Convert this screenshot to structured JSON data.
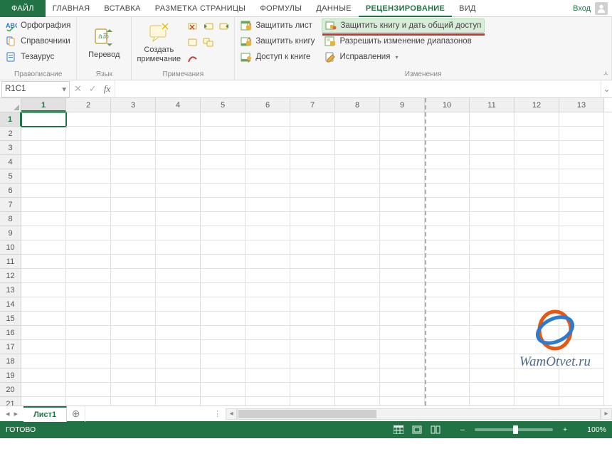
{
  "tabs": {
    "file": "ФАЙЛ",
    "home": "ГЛАВНАЯ",
    "insert": "ВСТАВКА",
    "page_layout": "РАЗМЕТКА СТРАНИЦЫ",
    "formulas": "ФОРМУЛЫ",
    "data": "ДАННЫЕ",
    "review": "РЕЦЕНЗИРОВАНИЕ",
    "view": "ВИД",
    "sign_in": "Вход"
  },
  "ribbon": {
    "proofing_group": "Правописание",
    "spelling": "Орфография",
    "research": "Справочники",
    "thesaurus": "Тезаурус",
    "language_group": "Язык",
    "translate": "Перевод",
    "comments_group": "Примечания",
    "new_comment": "Создать примечание",
    "changes_group": "Изменения",
    "protect_sheet": "Защитить лист",
    "protect_book": "Защитить книгу",
    "share_book": "Доступ к книге",
    "protect_share": "Защитить книгу и дать общий доступ",
    "allow_ranges": "Разрешить изменение диапазонов",
    "track_changes": "Исправления"
  },
  "formula_bar": {
    "name_box": "R1C1"
  },
  "grid": {
    "columns": [
      "1",
      "2",
      "3",
      "4",
      "5",
      "6",
      "7",
      "8",
      "9",
      "10",
      "11",
      "12",
      "13"
    ],
    "rows": [
      "1",
      "2",
      "3",
      "4",
      "5",
      "6",
      "7",
      "8",
      "9",
      "10",
      "11",
      "12",
      "13",
      "14",
      "15",
      "16",
      "17",
      "18",
      "19",
      "20",
      "21"
    ]
  },
  "sheet": {
    "tab1": "Лист1"
  },
  "status": {
    "ready": "ГОТОВО",
    "zoom": "100%"
  },
  "watermark": "WamOtvet.ru"
}
